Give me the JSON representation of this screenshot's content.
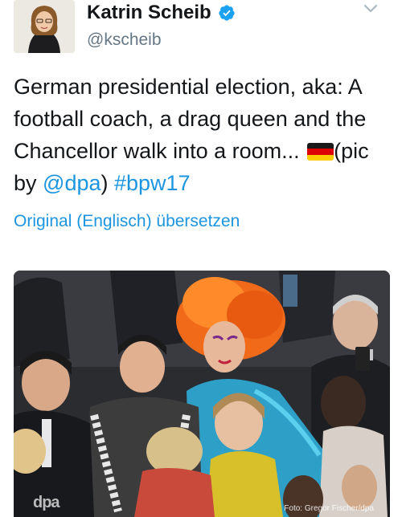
{
  "author": {
    "name": "Katrin Scheib",
    "handle": "@kscheib",
    "avatar_icon": "profile-photo",
    "verified_icon": "verified-badge-icon"
  },
  "menu_icon": "chevron-down-icon",
  "tweet": {
    "text_main": "German presidential election, aka: A football coach, a drag queen and the Chancellor walk into a room... ",
    "flag_icon": "germany-flag-emoji",
    "text_pic": "(pic by ",
    "mention": "@dpa",
    "text_close": ") ",
    "hashtag": "#bpw17"
  },
  "translate_label": "Original (Englisch) übersetzen",
  "photo": {
    "watermark": "dpa",
    "credit": "Foto: Gregor Fischer/dpa"
  },
  "colors": {
    "link": "#1b95e0",
    "verified": "#1da1f2",
    "secondary_text": "#657786"
  }
}
